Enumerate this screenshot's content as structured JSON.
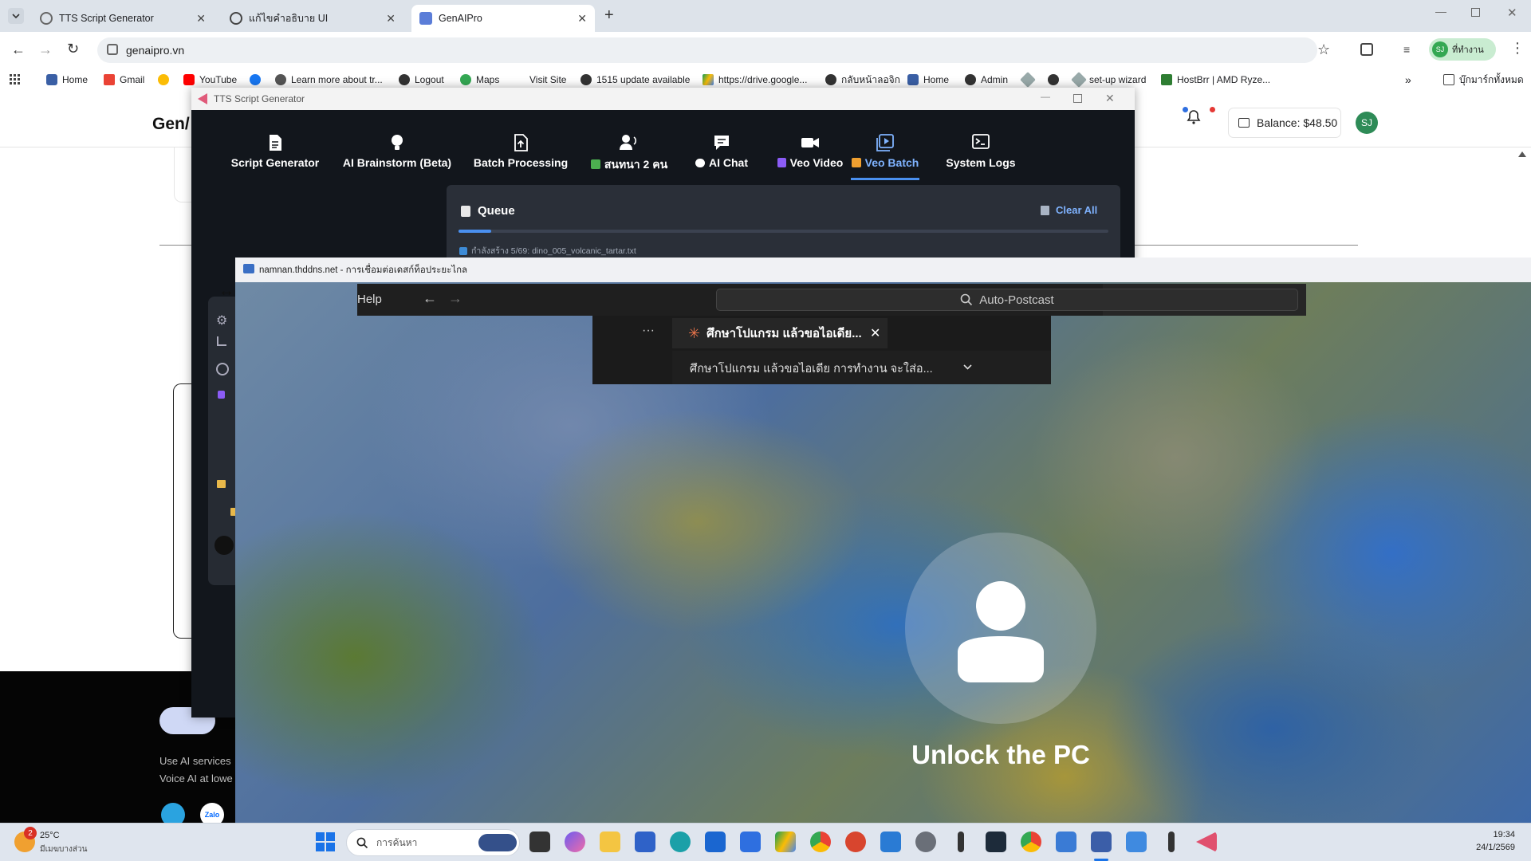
{
  "browser": {
    "tabs": [
      {
        "label": "TTS Script Generator"
      },
      {
        "label": "แก้ไขคำอธิบาย UI"
      },
      {
        "label": "GenAIPro"
      }
    ],
    "url": "genaipro.vn",
    "profile_label": "ที่ทำงาน",
    "profile_initials": "SJ",
    "bookmarks": [
      {
        "label": "Home"
      },
      {
        "label": "Gmail"
      },
      {
        "label": "YouTube"
      },
      {
        "label": "Learn more about tr..."
      },
      {
        "label": "Logout"
      },
      {
        "label": "Maps"
      },
      {
        "label": "Visit Site"
      },
      {
        "label": "1515 update available"
      },
      {
        "label": "https://drive.google..."
      },
      {
        "label": "กลับหน้าลอจิก"
      },
      {
        "label": "Home"
      },
      {
        "label": "Admin"
      },
      {
        "label": "set-up wizard"
      },
      {
        "label": "HostBrr | AMD Ryze..."
      }
    ],
    "bookmarks_folder": "บุ๊กมาร์กทั้งหมด"
  },
  "webpage": {
    "logo_partial": "Gen/",
    "balance": "Balance: $48.50",
    "avatar_initials": "SJ",
    "footer_lines": [
      "Use AI services",
      "Voice AI at lowe"
    ],
    "footer_social": "Zalo"
  },
  "tts_app": {
    "window_title": "TTS Script Generator",
    "nav": [
      {
        "label": "Script Generator"
      },
      {
        "label": "AI Brainstorm (Beta)"
      },
      {
        "label": "Batch Processing"
      },
      {
        "label": "สนทนา 2 คน"
      },
      {
        "label": "AI Chat"
      },
      {
        "label": "Veo Video"
      },
      {
        "label": "Veo Batch"
      },
      {
        "label": "System Logs"
      }
    ],
    "queue": {
      "title": "Queue",
      "clear_label": "Clear All",
      "progress": 0.05,
      "status_line": "กำลังสร้าง 5/69: dino_005_volcanic_tartar.txt"
    }
  },
  "remote": {
    "title": "namnan.thddns.net - การเชื่อมต่อเดสก์ท็อประยะไกล",
    "help_label": "Help",
    "search_text": "Auto-Postcast",
    "more_label": "···",
    "chat_tab": "ศึกษาโปแกรม แล้วขอไอเดีย...",
    "chat_subtitle": "ศึกษาโปแกรม แล้วขอไอเดีย การทำงาน จะใส่อ...",
    "unlock_text": "Unlock the PC"
  },
  "taskbar": {
    "weather_temp": "25°C",
    "weather_desc": "มีเมฆบางส่วน",
    "weather_badge": "2",
    "search_placeholder": "การค้นหา",
    "time": "19:34",
    "date": "24/1/2569"
  },
  "colors": {
    "accent": "#4a90f0",
    "app_bg": "#12161c",
    "chrome_bg": "#dde3ea",
    "profile_green": "#34a853"
  }
}
